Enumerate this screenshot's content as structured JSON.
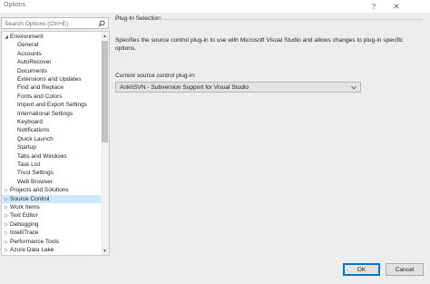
{
  "window": {
    "title": "Options",
    "help_glyph": "?",
    "close_glyph": "✕"
  },
  "search": {
    "placeholder": "Search Options (Ctrl+E)"
  },
  "tree": {
    "items": [
      {
        "label": "Environment",
        "level": 0,
        "expanded": true,
        "selected": false
      },
      {
        "label": "General",
        "level": 1,
        "selected": false
      },
      {
        "label": "Accounts",
        "level": 1,
        "selected": false
      },
      {
        "label": "AutoRecover",
        "level": 1,
        "selected": false
      },
      {
        "label": "Documents",
        "level": 1,
        "selected": false
      },
      {
        "label": "Extensions and Updates",
        "level": 1,
        "selected": false
      },
      {
        "label": "Find and Replace",
        "level": 1,
        "selected": false
      },
      {
        "label": "Fonts and Colors",
        "level": 1,
        "selected": false
      },
      {
        "label": "Import and Export Settings",
        "level": 1,
        "selected": false
      },
      {
        "label": "International Settings",
        "level": 1,
        "selected": false
      },
      {
        "label": "Keyboard",
        "level": 1,
        "selected": false
      },
      {
        "label": "Notifications",
        "level": 1,
        "selected": false
      },
      {
        "label": "Quick Launch",
        "level": 1,
        "selected": false
      },
      {
        "label": "Startup",
        "level": 1,
        "selected": false
      },
      {
        "label": "Tabs and Windows",
        "level": 1,
        "selected": false
      },
      {
        "label": "Task List",
        "level": 1,
        "selected": false
      },
      {
        "label": "Trust Settings",
        "level": 1,
        "selected": false
      },
      {
        "label": "Web Browser",
        "level": 1,
        "selected": false
      },
      {
        "label": "Projects and Solutions",
        "level": 0,
        "expanded": false,
        "selected": false
      },
      {
        "label": "Source Control",
        "level": 0,
        "expanded": false,
        "selected": true
      },
      {
        "label": "Work Items",
        "level": 0,
        "expanded": false,
        "selected": false
      },
      {
        "label": "Text Editor",
        "level": 0,
        "expanded": false,
        "selected": false
      },
      {
        "label": "Debugging",
        "level": 0,
        "expanded": false,
        "selected": false
      },
      {
        "label": "IntelliTrace",
        "level": 0,
        "expanded": false,
        "selected": false
      },
      {
        "label": "Performance Tools",
        "level": 0,
        "expanded": false,
        "selected": false
      },
      {
        "label": "Azure Data Lake",
        "level": 0,
        "expanded": false,
        "selected": false
      }
    ]
  },
  "panel": {
    "section_title": "Plug-In Selection:",
    "description": "Specifies the source control plug-in to use with Microsoft Visual Studio and allows changes to plug-in specific options.",
    "field_label": "Current source control plug-in:",
    "selected_plugin": "AnkhSVN - Subversion Support for Visual Studio"
  },
  "buttons": {
    "ok_label": "OK",
    "cancel_label": "Cancel"
  },
  "colors": {
    "selection": "#cce8ff",
    "accent": "#0078d7"
  },
  "icons": {
    "search": "search-icon",
    "dropdown": "chevron-down-icon",
    "expand_collapsed": "caret-right-icon",
    "expand_open": "caret-down-icon"
  }
}
